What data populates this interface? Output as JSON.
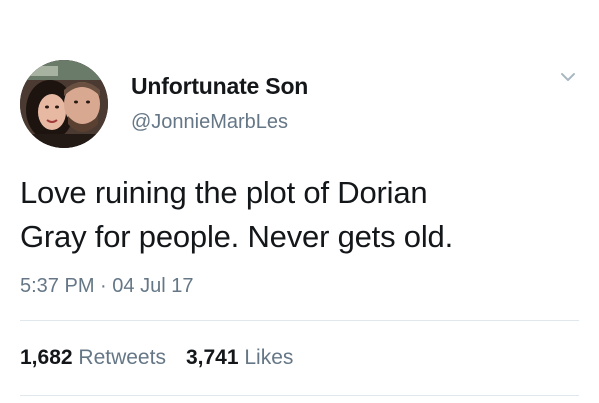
{
  "tweet": {
    "display_name": "Unfortunate Son",
    "handle": "@JonnieMarbLes",
    "text_lines": [
      "Love ruining the plot of Dorian",
      "Gray for people. Never gets old."
    ],
    "time": "5:37 PM",
    "separator": "·",
    "date": "04 Jul 17",
    "retweets_count": "1,682",
    "retweets_label": "Retweets",
    "likes_count": "3,741",
    "likes_label": "Likes"
  },
  "icons": {
    "avatar": "profile-photo",
    "menu": "chevron-down-icon"
  },
  "colors": {
    "text": "#14171a",
    "secondary": "#657786",
    "divider": "#e1e8ed"
  }
}
